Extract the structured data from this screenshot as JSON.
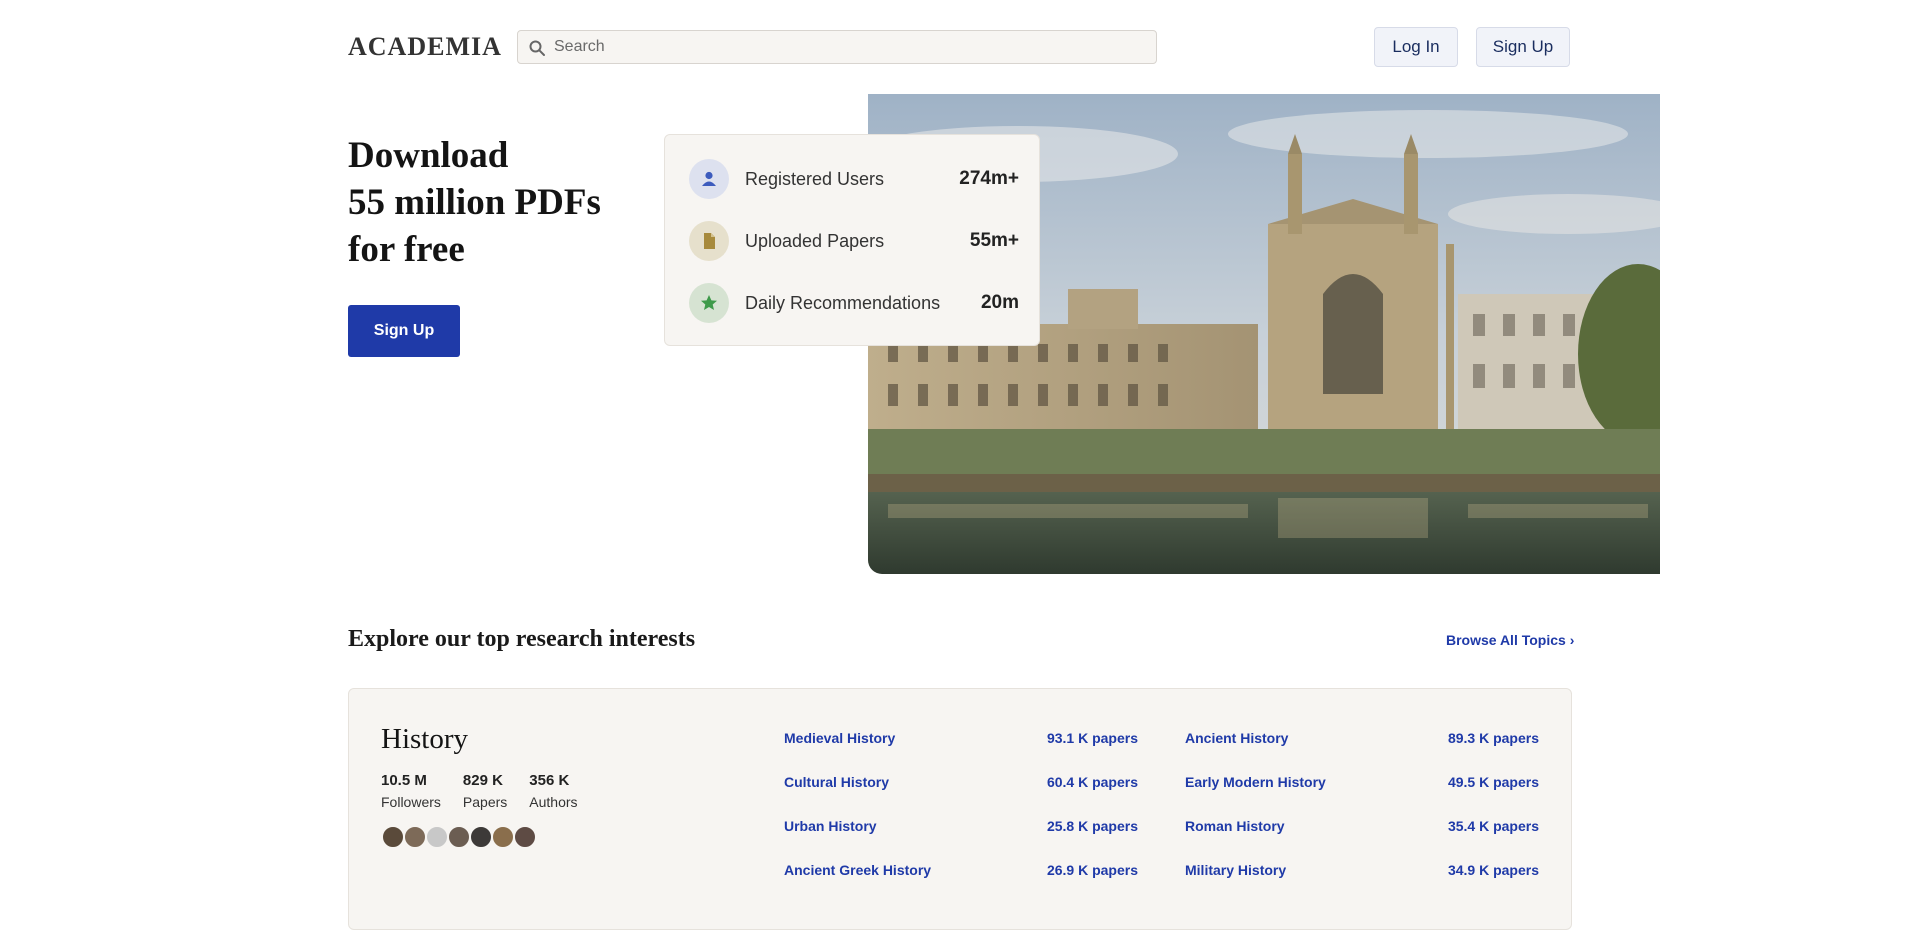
{
  "header": {
    "logo": "ACADEMIA",
    "search_placeholder": "Search",
    "login_label": "Log In",
    "signup_label": "Sign Up"
  },
  "hero": {
    "title_lines": [
      "Download",
      "55 million PDFs",
      "for free"
    ],
    "signup_label": "Sign Up",
    "stats": [
      {
        "label": "Registered Users",
        "value": "274m+",
        "icon": "user-icon",
        "color": "#3c5bbd"
      },
      {
        "label": "Uploaded Papers",
        "value": "55m+",
        "icon": "document-icon",
        "color": "#a78a3c"
      },
      {
        "label": "Daily Recommendations",
        "value": "20m",
        "icon": "star-icon",
        "color": "#3e9a4a"
      }
    ]
  },
  "explore": {
    "title": "Explore our top research interests",
    "browse_label": "Browse All Topics",
    "topic": {
      "name": "History",
      "stats": [
        {
          "value": "10.5 M",
          "label": "Followers"
        },
        {
          "value": "829 K",
          "label": "Papers"
        },
        {
          "value": "356 K",
          "label": "Authors"
        }
      ],
      "subtopics_col1": [
        {
          "name": "Medieval History",
          "count": "93.1 K papers"
        },
        {
          "name": "Cultural History",
          "count": "60.4 K papers"
        },
        {
          "name": "Urban History",
          "count": "25.8 K papers"
        },
        {
          "name": "Ancient Greek History",
          "count": "26.9 K papers"
        }
      ],
      "subtopics_col2": [
        {
          "name": "Ancient History",
          "count": "89.3 K papers"
        },
        {
          "name": "Early Modern History",
          "count": "49.5 K papers"
        },
        {
          "name": "Roman History",
          "count": "35.4 K papers"
        },
        {
          "name": "Military History",
          "count": "34.9 K papers"
        }
      ]
    }
  },
  "colors": {
    "brand_blue": "#1f3aa8",
    "card_bg": "#f7f5f2"
  }
}
